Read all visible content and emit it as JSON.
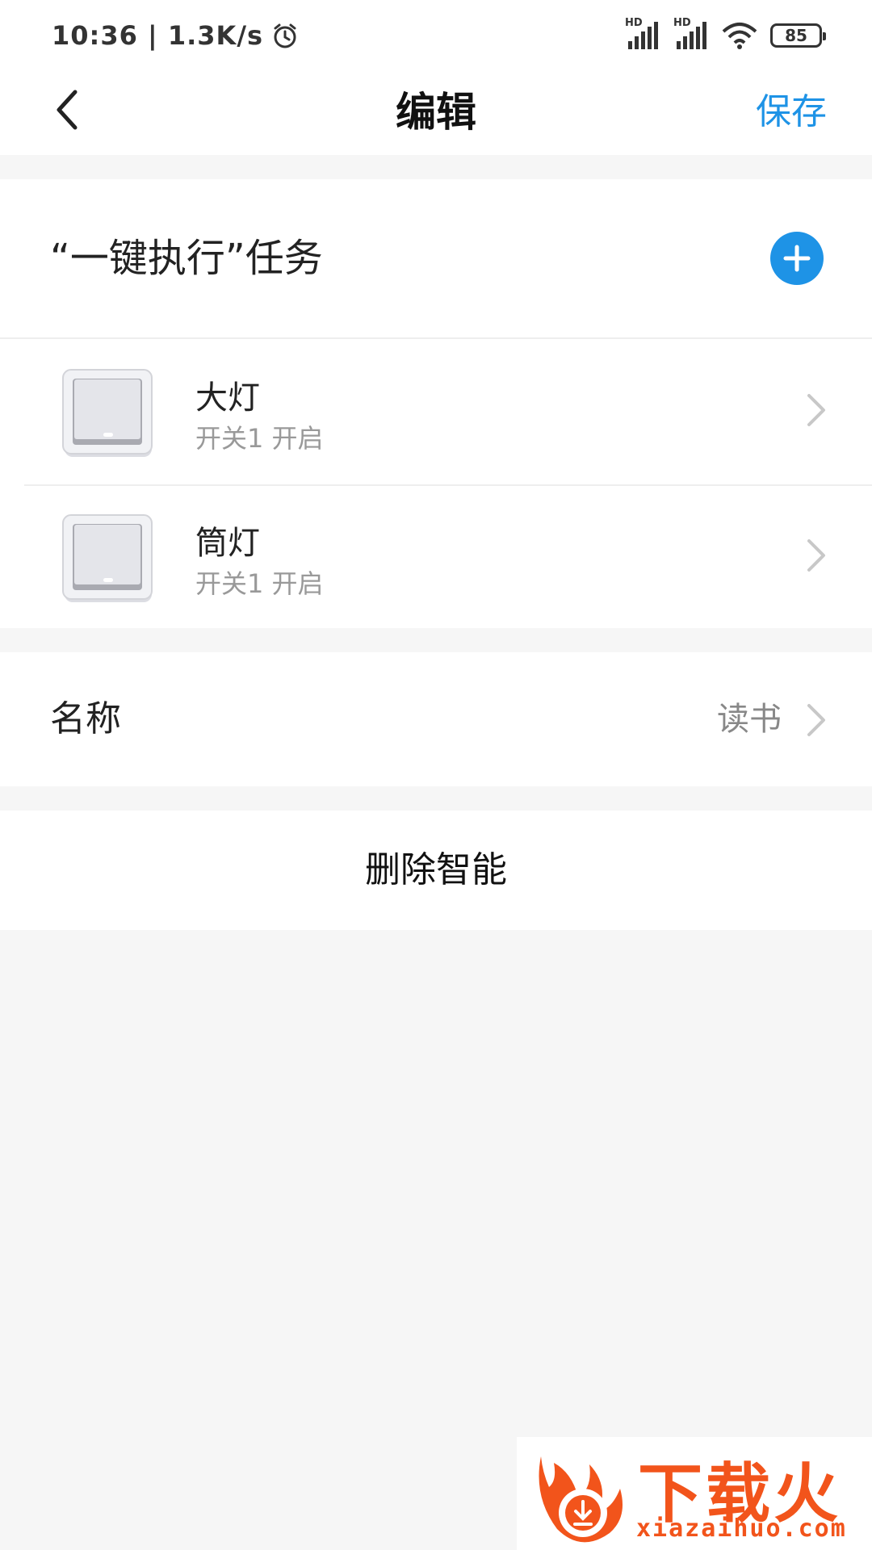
{
  "status": {
    "time_speed": "10:36 | 1.3K/s",
    "battery": "85",
    "signal1": "HD",
    "signal2": "HD"
  },
  "nav": {
    "title": "编辑",
    "save_label": "保存"
  },
  "task_section": {
    "title": "“一键执行”任务",
    "items": [
      {
        "name": "大灯",
        "status": "开关1 开启"
      },
      {
        "name": "筒灯",
        "status": "开关1 开启"
      }
    ]
  },
  "name_row": {
    "label": "名称",
    "value": "读书"
  },
  "delete_label": "删除智能",
  "watermark": {
    "title": "下载火",
    "url": "xiazaihuo.com"
  },
  "colors": {
    "accent": "#1e93e6",
    "background": "#f6f6f6",
    "watermark": "#f2541b"
  }
}
